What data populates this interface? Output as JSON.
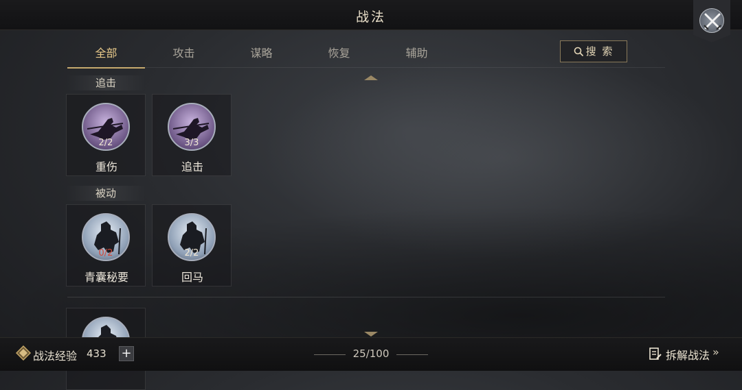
{
  "header": {
    "title": "战法"
  },
  "tabs": [
    {
      "label": "全部",
      "active": true
    },
    {
      "label": "攻击",
      "active": false
    },
    {
      "label": "谋略",
      "active": false
    },
    {
      "label": "恢复",
      "active": false
    },
    {
      "label": "辅助",
      "active": false
    }
  ],
  "search": {
    "label": "搜 索"
  },
  "sections": [
    {
      "label": "追击",
      "cards": [
        {
          "name": "重伤",
          "count": "2/2"
        },
        {
          "name": "追击",
          "count": "3/3"
        }
      ]
    },
    {
      "label": "被动",
      "cards": [
        {
          "name": "青囊秘要",
          "count": "0/2"
        },
        {
          "name": "回马",
          "count": "2/2"
        }
      ]
    }
  ],
  "footer": {
    "exp_label": "战法经验",
    "exp_value": "433",
    "plus_label": "+",
    "capacity": "25/100",
    "dismantle_label": "拆解战法",
    "chevron": "»"
  },
  "colors": {
    "accent": "#c5a768",
    "count_warning": "#d24a3a"
  },
  "icons": [
    "close-swords-icon",
    "search-icon",
    "purple-rider-skill-icon",
    "blue-warrior-skill-icon",
    "exp-icon",
    "dismantle-icon"
  ]
}
